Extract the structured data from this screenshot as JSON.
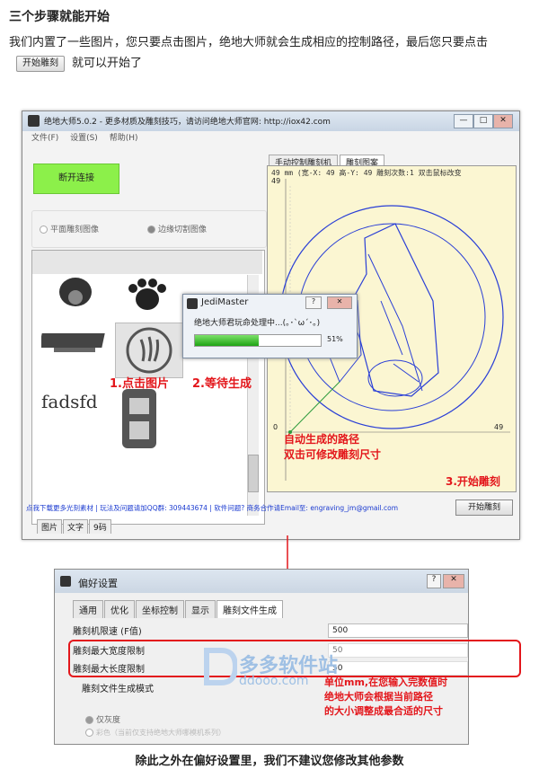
{
  "heading": "三个步骤就能开始",
  "intro": {
    "text_before": "我们内置了一些图片，您只要点击图片，绝地大师就会生成相应的控制路径，最后您只要点击",
    "button_label": "开始雕刻",
    "text_after": "就可以开始了"
  },
  "main_window": {
    "title": "绝地大师5.0.2 - 更多材质及雕刻技巧，请访问绝地大师官网: http://iox42.com",
    "menu": [
      "文件(F)",
      "设置(S)",
      "帮助(H)"
    ],
    "connect_button": "断开连接",
    "radio_options": [
      "平面雕刻图像",
      "边缘切割图像"
    ],
    "gallery_text_thumb": "fadsfd",
    "bottom_tabs": [
      "图片",
      "文字",
      "9码"
    ],
    "right_tabs": [
      "手动控制雕刻机",
      "雕刻图案"
    ],
    "canvas_coords": "49 mm (宽-X: 49 高-Y: 49  雕刻次数:1  双击鼠标改变",
    "canvas_axis_left": "49",
    "canvas_axis_x": "49",
    "canvas_zero": "0",
    "status_text": "点我下载更多光刻素材 | 玩法及问题请加QQ群: 309443674 | 软件问题? 商务合作请Email至: engraving_jm@gmail.com",
    "start_button": "开始雕刻"
  },
  "progress_dialog": {
    "title": "JediMaster",
    "message": "绝地大师君玩命处理中...(｡･`ω´･｡)",
    "percent_label": "51%",
    "percent": 51
  },
  "annotations": {
    "step1": "1.点击图片",
    "step2": "2.等待生成",
    "auto_path_line1": "自动生成的路径",
    "auto_path_line2": "双击可修改雕刻尺寸",
    "step3": "3.开始雕刻",
    "unit_line1": "单位mm,在您输入完数值时",
    "unit_line2": "绝地大师会根据当前路径",
    "unit_line3": "的大小调整成最合适的尺寸"
  },
  "settings_dialog": {
    "title": "偏好设置",
    "tabs": [
      "通用",
      "优化",
      "坐标控制",
      "显示",
      "雕刻文件生成"
    ],
    "rows": [
      {
        "label": "雕刻机限速 (F值)",
        "value": "500"
      },
      {
        "label": "雕刻最大宽度限制",
        "value": "50"
      },
      {
        "label": "雕刻最大长度限制",
        "value": "50"
      }
    ],
    "mode_label": "雕刻文件生成模式",
    "mode_options": [
      "仅灰度",
      "彩色（当前仅支持绝地大师哪模机系列）"
    ],
    "watermark_cn": "多多软件站",
    "watermark_url": "ddooo.com"
  },
  "footer": "除此之外在偏好设置里，我们不建议您修改其他参数"
}
